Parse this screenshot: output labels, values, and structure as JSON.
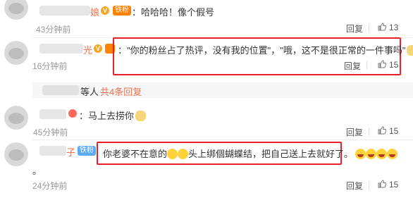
{
  "comments": [
    {
      "name_tail": "娘",
      "badge": "铁粉",
      "text": "：哈哈哈！像个假号",
      "time": "43分钟前",
      "reply": "回复",
      "likes": "13"
    },
    {
      "name_tail": "光",
      "text": "：\"你的粉丝占了热评，没有我的位置\"，\"哦，这不是很正常的一件事吗\"",
      "time": "16分钟前",
      "reply": "回复",
      "likes": "15"
    },
    {
      "text": "：马上去捞你",
      "time": "45分钟前",
      "reply": "回复",
      "likes": "15"
    },
    {
      "name_tail": "子",
      "badge": "铁粉",
      "text_a": "你老婆不在意的",
      "text_b": "头上绑個蝴蝶结，把自己送上去就好了。",
      "text_c": "。",
      "time": "24分钟前",
      "reply": "回复",
      "likes": "15"
    }
  ],
  "sub_replies": {
    "label_people": "等人",
    "label_count": "共4条回复"
  },
  "colors": {
    "highlight": "#e8202a",
    "link": "#eb7350",
    "badge_orange": "#ff8200",
    "badge_blue": "#5cabf1"
  },
  "icons": [
    "thumb-up-icon",
    "vip-v-icon",
    "laugh-emoji-icon",
    "dog-emoji-icon"
  ]
}
